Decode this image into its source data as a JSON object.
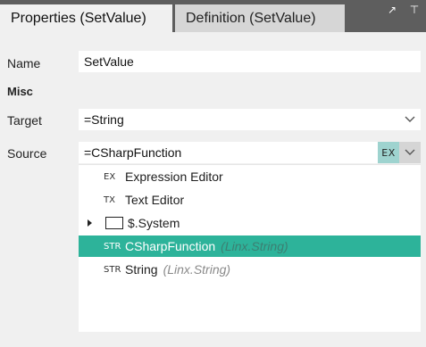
{
  "tabs": {
    "properties": "Properties (SetValue)",
    "definition": "Definition (SetValue)"
  },
  "window_icons": {
    "expand": "↗",
    "pin": "⊤"
  },
  "fields": {
    "name_label": "Name",
    "name_value": "SetValue",
    "section_misc": "Misc",
    "target_label": "Target",
    "target_value": "=String",
    "source_label": "Source",
    "source_value": "=CSharpFunction",
    "source_badge": "EX"
  },
  "dropdown": {
    "items": [
      {
        "icon": "EX",
        "label": "Expression Editor",
        "type": ""
      },
      {
        "icon": "TX",
        "label": "Text Editor",
        "type": ""
      },
      {
        "icon": "folder-icon",
        "label": "$.System",
        "type": ""
      },
      {
        "icon": "STR",
        "label": "CSharpFunction",
        "type": "(Linx.String)"
      },
      {
        "icon": "STR",
        "label": "String",
        "type": "(Linx.String)"
      }
    ],
    "selected_index": 3
  },
  "colors": {
    "accent": "#2db39a",
    "badge": "#9ed3cf",
    "tab_bar": "#5e5e5e"
  }
}
